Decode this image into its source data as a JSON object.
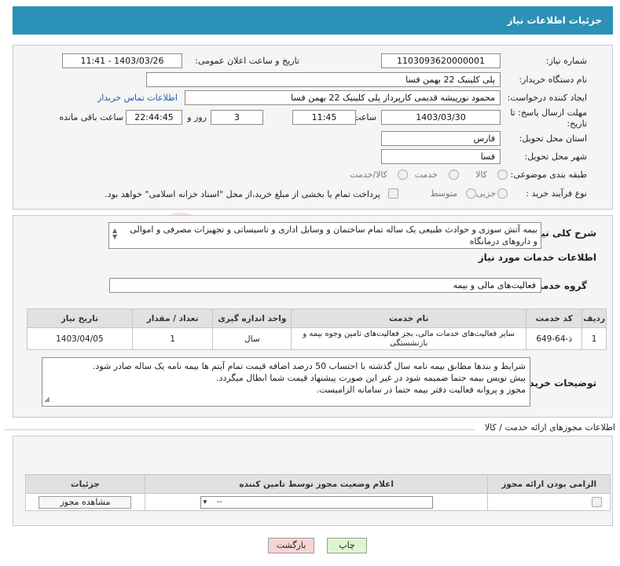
{
  "header": {
    "title": "جزئیات اطلاعات نیاز"
  },
  "form": {
    "need_number_label": "شماره نیاز:",
    "need_number": "1103093620000001",
    "announce_label": "تاریخ و ساعت اعلان عمومی:",
    "announce_value": "1403/03/26 - 11:41",
    "buyer_org_label": "نام دستگاه خریدار:",
    "buyer_org": "پلی کلینیک 22 بهمن فسا",
    "requester_label": "ایجاد کننده درخواست:",
    "requester": "محمود نورپیشه قدیمی کارپرداز پلی کلینیک 22 بهمن فسا",
    "contact_link": "اطلاعات تماس خریدار",
    "deadline_label": "مهلت ارسال پاسخ: تا تاریخ:",
    "deadline_date": "1403/03/30",
    "time_label": "ساعت",
    "deadline_time": "11:45",
    "days_value": "3",
    "days_label": "روز و",
    "remaining_time": "22:44:45",
    "remaining_label": "ساعت باقی مانده",
    "province_label": "استان محل تحویل:",
    "province": "فارس",
    "city_label": "شهر محل تحویل:",
    "city": "فسا",
    "category_label": "طبقه بندی موضوعی:",
    "category_options": [
      "کالا",
      "خدمت",
      "کالا/خدمت"
    ],
    "process_label": "نوع فرآیند خرید :",
    "process_options": [
      "جزیی",
      "متوسط"
    ],
    "payment_note": "پرداخت تمام یا بخشی از مبلغ خرید،از محل \"اسناد خزانه اسلامی\" خواهد بود."
  },
  "summary": {
    "label": "شرح کلی نیاز:",
    "text": "بیمه آتش سوزی و حوادث طبیعی یک ساله تمام ساختمان و وسایل اداری و تاسیساتی و تجهیزات مصرفی و اموالی و داروهای درمانگاه"
  },
  "services": {
    "section_title": "اطلاعات خدمات مورد نیاز",
    "group_label": "گروه خدمت:",
    "group_value": "فعالیت‌های مالی و بیمه",
    "columns": [
      "ردیف",
      "کد خدمت",
      "نام خدمت",
      "واحد اندازه گیری",
      "تعداد / مقدار",
      "تاریخ نیاز"
    ],
    "rows": [
      [
        "1",
        "ذ-64-649",
        "سایر فعالیت‌های خدمات مالی، بجز فعالیت‌های تامین وجوه بیمه و بازنشستگی",
        "سال",
        "1",
        "1403/04/05"
      ]
    ]
  },
  "buyer_notes": {
    "label": "توضیحات خریدار:",
    "lines": [
      "شرایط و بندها مطابق بیمه نامه سال گذشته با احتساب 50 درصد اضافه قیمت تمام آیتم ها بیمه نامه یک ساله صادر شود.",
      "پیش نویس بیمه حتما ضمیمه شود در غیر این صورت پیشنهاد قیمت شما ابطال میگردد.",
      "مجوز و پروانه فعالیت دفتر بیمه حتما در سامانه الزامیست."
    ]
  },
  "permits": {
    "title": "اطلاعات مجوزهای ارائه خدمت / کالا",
    "columns": [
      "الزامی بودن ارائه مجوز",
      "اعلام وضعیت مجوز توسط تامین کننده",
      "جزئیات"
    ],
    "select_value": "--",
    "view_button": "مشاهده مجوز"
  },
  "actions": {
    "print": "چاپ",
    "back": "بازگشت"
  },
  "watermark_text": "AriaTender.neT",
  "colors": {
    "header": "#2b91b7",
    "back_button": "#f7d4d4",
    "print_button": "#dff5d2",
    "link": "#1f5fa8"
  }
}
